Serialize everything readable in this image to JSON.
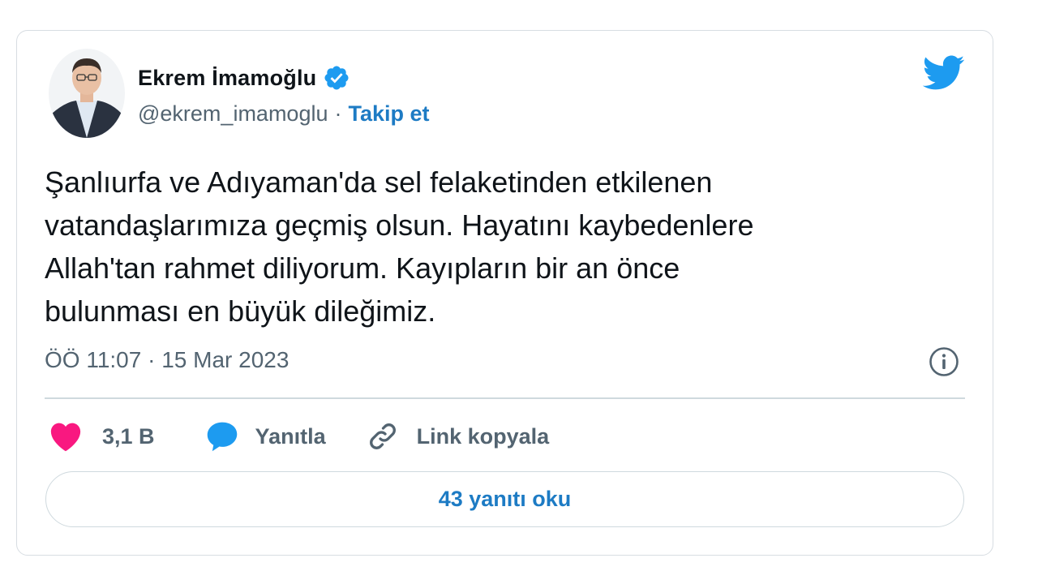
{
  "author": {
    "name": "Ekrem İmamoğlu",
    "handle": "@ekrem_imamoglu",
    "separator": "·",
    "follow_label": "Takip et",
    "verified_icon": "verified-badge-icon",
    "verified_color": "#1d9bf0"
  },
  "brand": {
    "icon": "twitter-bird-icon",
    "color": "#1d9bf0"
  },
  "tweet": {
    "text": "Şanlıurfa ve Adıyaman'da sel felaketinden etkilenen\nvatandaşlarımıza geçmiş olsun. Hayatını kaybedenlere\nAllah'tan rahmet diliyorum. Kayıpların bir an önce\nbulunması en büyük dileğimiz.",
    "timestamp": "ÖÖ 11:07 · 15 Mar 2023"
  },
  "actions": {
    "like_count": "3,1 B",
    "like_color": "#f91880",
    "reply_label": "Yanıtla",
    "reply_color": "#1d9bf0",
    "copy_link_label": "Link kopyala"
  },
  "footer": {
    "read_replies_label": "43 yanıtı oku"
  }
}
